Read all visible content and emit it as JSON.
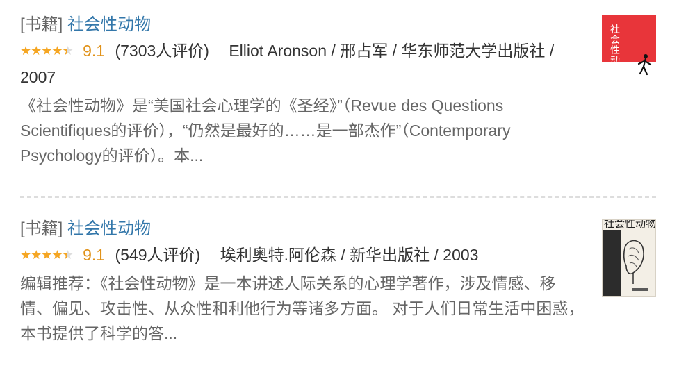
{
  "results": [
    {
      "category": "[书籍]",
      "title": "社会性动物",
      "rating": "9.1",
      "rating_count": "(7303人评价)",
      "star_value": 4.5,
      "meta_text": "Elliot Aronson / 邢占军 / 华东师范大学出版社 / 2007",
      "summary": "《社会性动物》是“美国社会心理学的《圣经》”（Revue des Questions Scientifiques的评价），“仍然是最好的……是一部杰作”（Contemporary Psychology的评价）。本...",
      "cover_title": "社会性动物"
    },
    {
      "category": "[书籍]",
      "title": "社会性动物",
      "rating": "9.1",
      "rating_count": "(549人评价)",
      "star_value": 4.5,
      "meta_text": "埃利奥特.阿伦森 / 新华出版社 / 2003",
      "summary": "编辑推荐：《社会性动物》是一本讲述人际关系的心理学著作，涉及情感、移情、偏见、攻击性、从众性和利他行为等诸多方面。 对于人们日常生活中困惑，本书提供了科学的答...",
      "cover_title": "社会性动物"
    }
  ],
  "colors": {
    "link": "#3377aa",
    "star": "#f5a623",
    "rating": "#e09015"
  }
}
